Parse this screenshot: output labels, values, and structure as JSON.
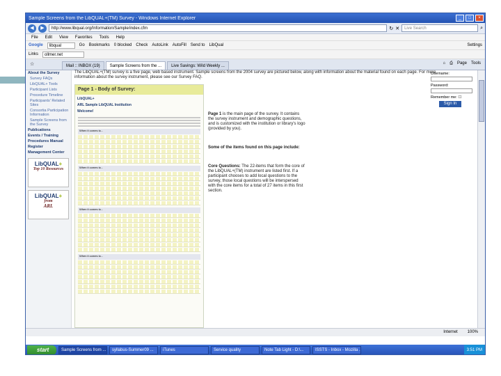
{
  "window": {
    "title": "Sample Screens from the LibQUAL+(TM) Survey - Windows Internet Explorer"
  },
  "address": {
    "url": "http://www.libqual.org/Information/Sample/index.cfm",
    "search_placeholder": "Live Search"
  },
  "menu": [
    "File",
    "Edit",
    "View",
    "Favorites",
    "Tools",
    "Help"
  ],
  "toolbar": {
    "google_label": "Google",
    "google_value": "libqual",
    "go_label": "Go",
    "items": [
      "Bookmarks",
      "0 blocked",
      "Check",
      "AutoLink",
      "AutoFill",
      "Send to",
      "LibQual"
    ],
    "settings_label": "Settings"
  },
  "links_bar": {
    "label": "Links",
    "value": "ollmer.net"
  },
  "tabs": [
    "Mail :: INBOX (19)",
    "Sample Screens from the ...",
    "Live Savings: Wild Weekly ..."
  ],
  "tab_tools": [
    "Page",
    "Tools"
  ],
  "sidebar": {
    "items": [
      {
        "label": "About the Survey",
        "kind": "head"
      },
      {
        "label": "Survey FAQs",
        "kind": "sub"
      },
      {
        "label": "LibQUAL+ Tools",
        "kind": "sub"
      },
      {
        "label": "Participant Lists",
        "kind": "sub"
      },
      {
        "label": "Procedure Timeline",
        "kind": "sub"
      },
      {
        "label": "Participants' Related Sites",
        "kind": "sub"
      },
      {
        "label": "Consortia Participation Information",
        "kind": "sub"
      },
      {
        "label": "Sample Screens from the Survey",
        "kind": "sub"
      },
      {
        "label": "Publications",
        "kind": "head"
      },
      {
        "label": "Events / Training",
        "kind": "head"
      },
      {
        "label": "Procedures Manual",
        "kind": "head"
      },
      {
        "label": "Register",
        "kind": "head"
      },
      {
        "label": "Management Center",
        "kind": "head"
      }
    ],
    "badge1": {
      "logo": "LibQUAL",
      "plus": "+",
      "caption": "Top 10 Resources"
    },
    "badge2": {
      "logo": "LibQUAL",
      "plus": "+",
      "from": "from",
      "org": "ARL"
    }
  },
  "intro_text": "The LibQUAL+(TM) survey is a five page, web based instrument. Sample screens from the 2004 survey are pictured below, along with information about the material found on each page. For more information about the survey instrument, please see our Survey FAQ.",
  "login": {
    "username_label": "Username:",
    "password_label": "Password:",
    "remember_label": "Remember me:",
    "signin_label": "Sign In"
  },
  "survey_page": {
    "heading": "Page 1 - Body of Survey:",
    "logo": "LibQUAL+",
    "institution": "ARL Sample LibQUAL Institution",
    "welcome": "Welcome!",
    "col_headers": [
      "My Minimum Service Level is",
      "My Desired Service Level is",
      "Perceived Service Performance is"
    ],
    "section_label": "When it comes to..."
  },
  "descriptions": [
    {
      "title": "Page 1",
      "text": " is the main page of the survey. It contains the survey instrument and demographic questions, and is customized with the institution or library's logo (provided by you)."
    },
    {
      "title": "Some of the items found on this page include:",
      "text": ""
    },
    {
      "title": "Core Questions:",
      "text": " The 22-items that form the core of the LibQUAL+(TM) instrument are listed first. If a participant chooses to add local questions to the survey, those local questions will be interspersed with the core items for a total of 27 items in this first section."
    }
  ],
  "status": {
    "zone": "Internet",
    "zoom": "100%"
  },
  "taskbar": {
    "start": "start",
    "tasks": [
      "Sample Screens from ...",
      "syllabus-Summer09 ...",
      "iTunes",
      "Service quality",
      "Note Tab Light - D:\\...",
      "ISSTS - Inbox - Mozilla ..."
    ],
    "clock": "3:51 PM"
  }
}
